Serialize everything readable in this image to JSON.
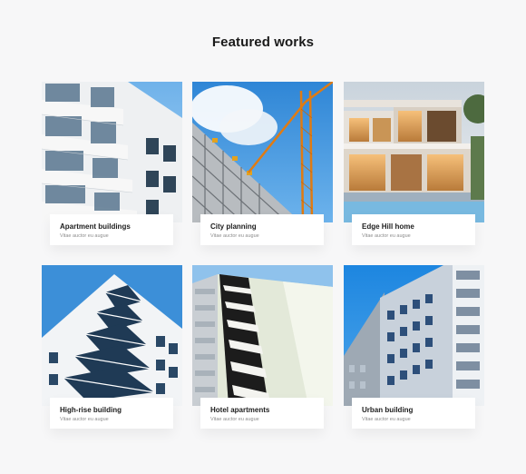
{
  "section": {
    "title": "Featured works"
  },
  "works": [
    {
      "title": "Apartment buildings",
      "subtitle": "Vitae auctor eu augue"
    },
    {
      "title": "City planning",
      "subtitle": "Vitae auctor eu augue"
    },
    {
      "title": "Edge Hill home",
      "subtitle": "Vitae auctor eu augue"
    },
    {
      "title": "High-rise building",
      "subtitle": "Vitae auctor eu augue"
    },
    {
      "title": "Hotel apartments",
      "subtitle": "Vitae auctor eu augue"
    },
    {
      "title": "Urban building",
      "subtitle": "Vitae auctor eu augue"
    }
  ],
  "colors": {
    "background": "#f7f7f8",
    "card": "#ffffff",
    "title_text": "#1a1a1a",
    "subtitle_text": "#8c8c8c",
    "sky": "#3d8fd6"
  }
}
